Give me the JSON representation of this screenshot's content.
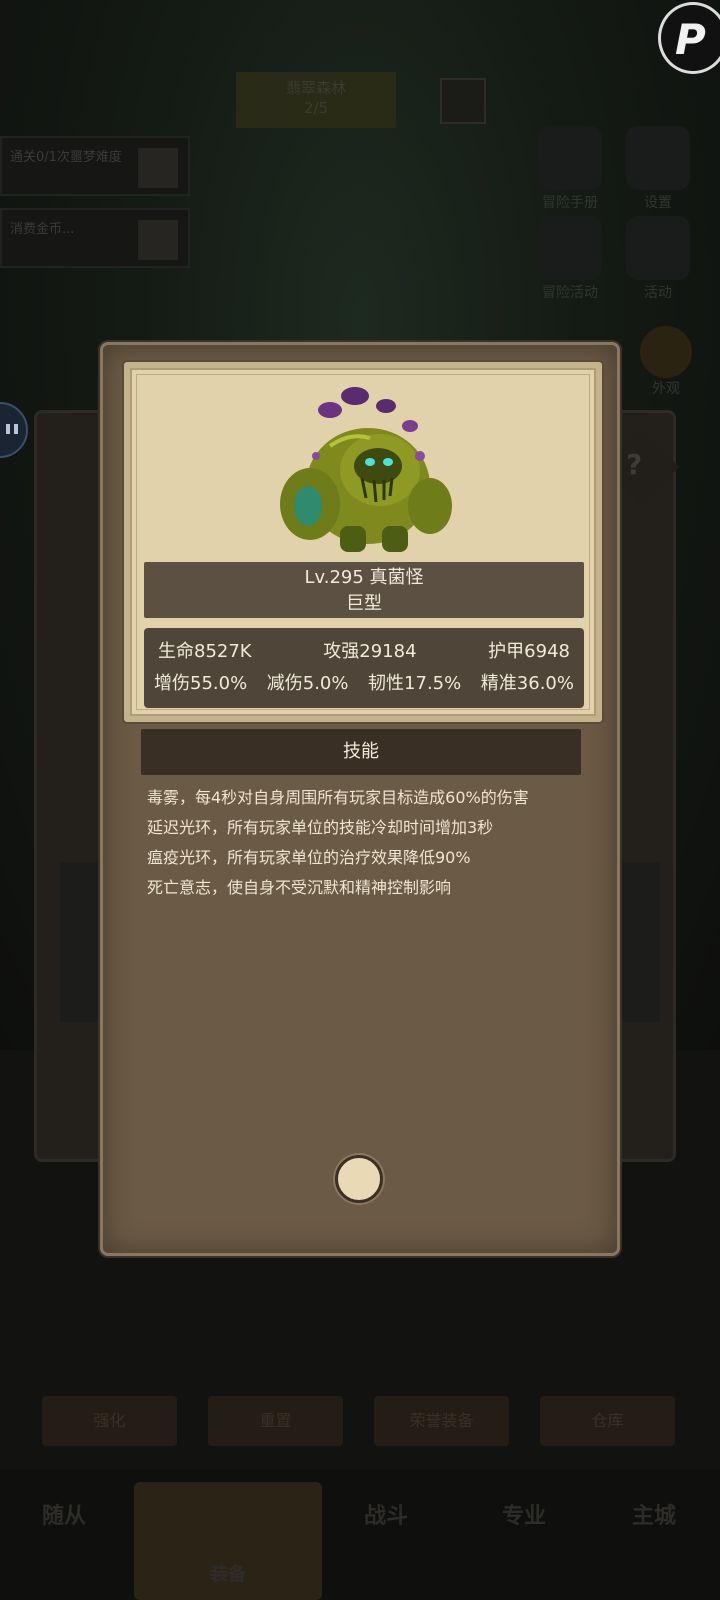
{
  "background": {
    "stage_title": "翡翠森林",
    "stage_progress": "2/5",
    "quests": [
      "通关0/1次噩梦难度",
      "消费金币..."
    ],
    "right_icons": [
      {
        "icon": "handbook-icon",
        "label": "冒险手册"
      },
      {
        "icon": "settings-icon",
        "label": "设置"
      },
      {
        "icon": "event-icon",
        "label": "冒险活动"
      },
      {
        "icon": "activity-icon",
        "label": "活动"
      },
      {
        "icon": "coin-icon",
        "label": "外观"
      }
    ],
    "tabs": [
      "强化",
      "重置",
      "荣誉装备",
      "仓库"
    ],
    "nav": [
      "随从",
      "装备",
      "战斗",
      "专业",
      "主城"
    ],
    "corner_button": "P"
  },
  "modal": {
    "monster_name_line": "Lv.295 真菌怪",
    "monster_size": "巨型",
    "monster_icon": "fungus-monster-portrait",
    "stats": {
      "row1": [
        "生命8527K",
        "攻强29184",
        "护甲6948"
      ],
      "row2": [
        "增伤55.0%",
        "减伤5.0%",
        "韧性17.5%",
        "精准36.0%"
      ]
    },
    "skills_title": "技能",
    "skills": [
      "毒雾，每4秒对自身周围所有玩家目标造成60%的伤害",
      "延迟光环，所有玩家单位的技能冷却时间增加3秒",
      "瘟疫光环，所有玩家单位的治疗效果降低90%",
      "死亡意志，使自身不受沉默和精神控制影响"
    ]
  },
  "colors": {
    "modal_bg": "#6b5a45",
    "card_bg": "#e2d2ac",
    "bar_dark": "#3a2f25",
    "text_light": "#f1ead8"
  }
}
